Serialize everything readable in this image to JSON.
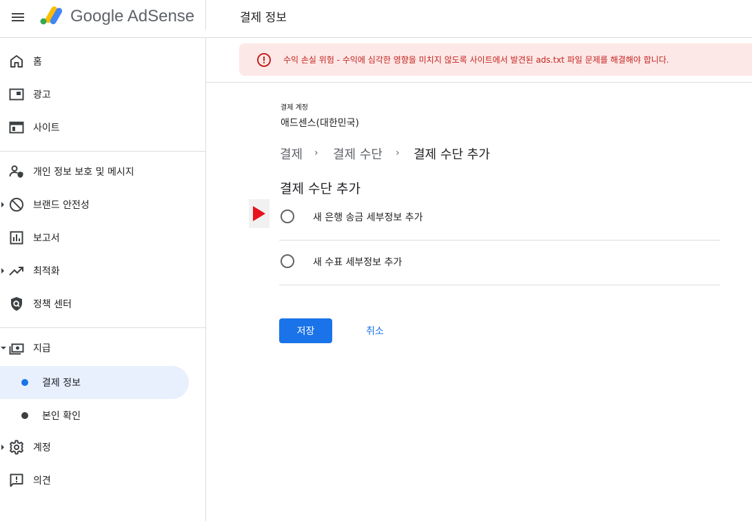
{
  "header": {
    "brand": "Google AdSense",
    "page_title": "결제 정보"
  },
  "sidebar": {
    "items": [
      {
        "label": "홈",
        "icon": "home-icon"
      },
      {
        "label": "광고",
        "icon": "ads-icon"
      },
      {
        "label": "사이트",
        "icon": "sites-icon"
      },
      {
        "label": "개인 정보 보호 및 메시지",
        "icon": "privacy-messaging-icon"
      },
      {
        "label": "브랜드 안전성",
        "icon": "block-icon"
      },
      {
        "label": "보고서",
        "icon": "reports-icon"
      },
      {
        "label": "최적화",
        "icon": "trending-up-icon"
      },
      {
        "label": "정책 센터",
        "icon": "policy-shield-icon"
      },
      {
        "label": "지급",
        "icon": "payments-icon"
      },
      {
        "label": "계정",
        "icon": "gear-icon"
      },
      {
        "label": "의견",
        "icon": "feedback-icon"
      }
    ],
    "payments_sub": [
      {
        "label": "결제 정보",
        "active": true
      },
      {
        "label": "본인 확인",
        "active": false
      }
    ]
  },
  "alert": {
    "text": "수익 손실 위험 - 수익에 심각한 영향을 미치지 않도록 사이트에서 발견된 ads.txt 파일 문제를 해결해야 합니다.",
    "icon": "error-icon",
    "color": "#c5221f",
    "background": "#fce8e6"
  },
  "account": {
    "label": "결제 계정",
    "value": "애드센스(대한민국)"
  },
  "breadcrumb": {
    "items": [
      "결제",
      "결제 수단",
      "결제 수단 추가"
    ],
    "separator": "›"
  },
  "section_title": "결제 수단 추가",
  "options": [
    {
      "label": "새 은행 송금 세부정보 추가",
      "selected": false
    },
    {
      "label": "새 수표 세부정보 추가",
      "selected": false
    }
  ],
  "actions": {
    "save_label": "저장",
    "cancel_label": "취소"
  },
  "colors": {
    "accent": "#1a73e8",
    "active_nav_bg": "#e8f0fe",
    "marker": "#e8121e"
  }
}
